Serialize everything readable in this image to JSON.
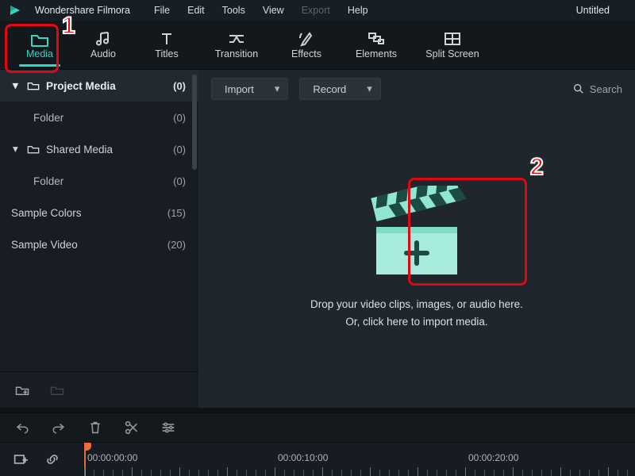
{
  "app": {
    "name": "Wondershare Filmora",
    "project_title": "Untitled"
  },
  "menu": {
    "file": "File",
    "edit": "Edit",
    "tools": "Tools",
    "view": "View",
    "export": "Export",
    "help": "Help"
  },
  "tabs": {
    "media": "Media",
    "audio": "Audio",
    "titles": "Titles",
    "transition": "Transition",
    "effects": "Effects",
    "elements": "Elements",
    "split": "Split Screen"
  },
  "sidebar": {
    "project": {
      "label": "Project Media",
      "count": "(0)",
      "folder_label": "Folder",
      "folder_count": "(0)"
    },
    "shared": {
      "label": "Shared Media",
      "count": "(0)",
      "folder_label": "Folder",
      "folder_count": "(0)"
    },
    "colors": {
      "label": "Sample Colors",
      "count": "(15)"
    },
    "video": {
      "label": "Sample Video",
      "count": "(20)"
    }
  },
  "main": {
    "import_label": "Import",
    "record_label": "Record",
    "search_placeholder": "Search",
    "drop_line1": "Drop your video clips, images, or audio here.",
    "drop_line2": "Or, click here to import media."
  },
  "timeline": {
    "t0": "00:00:00:00",
    "t1": "00:00:10:00",
    "t2": "00:00:20:00"
  },
  "annotations": {
    "one": "1",
    "two": "2"
  }
}
